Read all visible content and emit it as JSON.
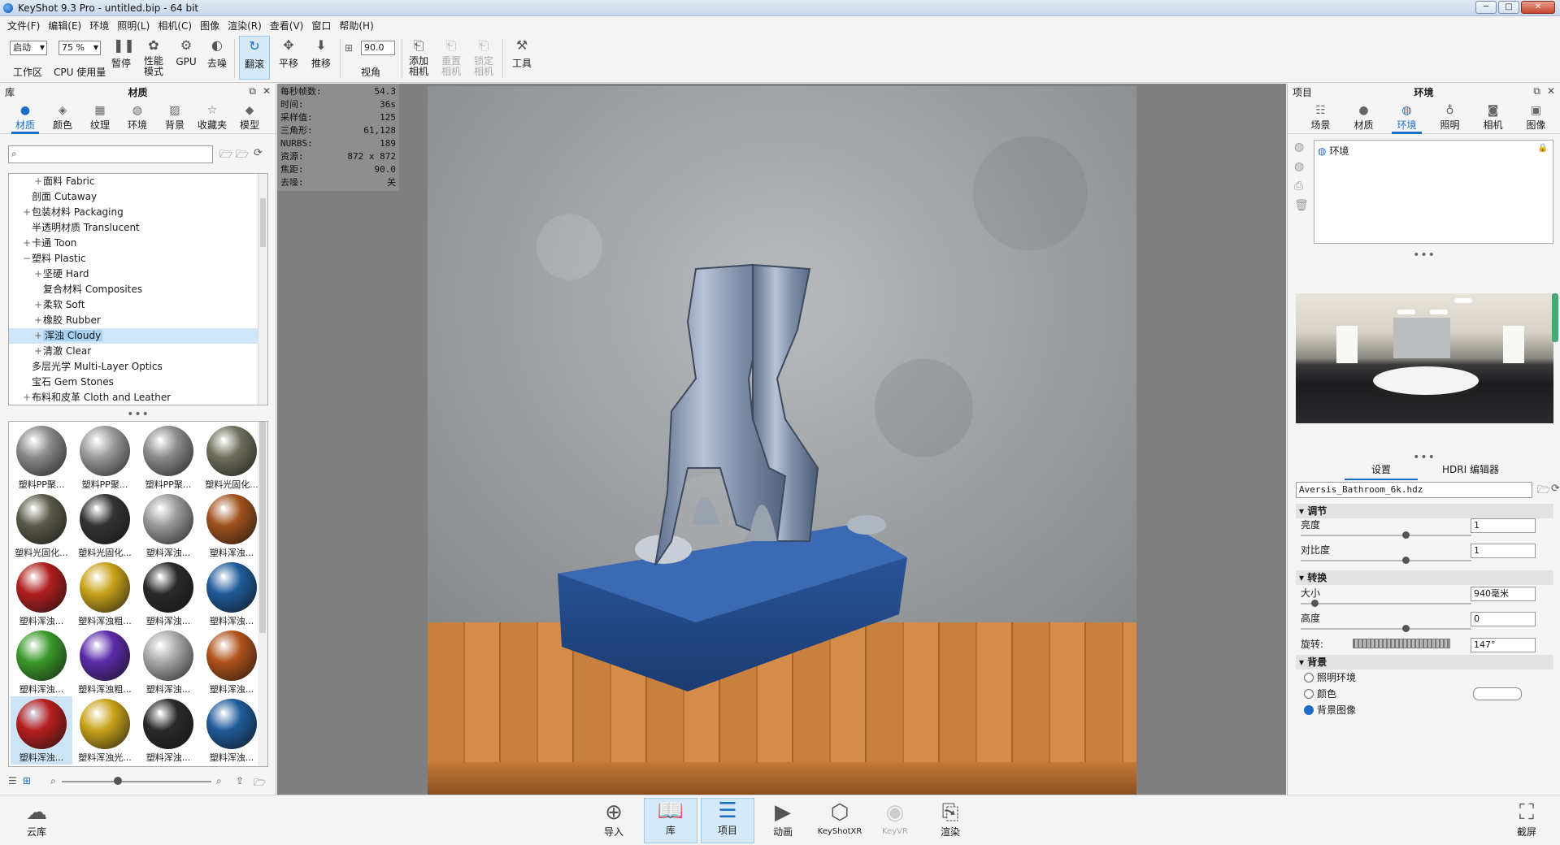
{
  "window": {
    "title": "KeyShot 9.3 Pro  - untitled.bip  - 64 bit",
    "min": "─",
    "max": "□",
    "close": "✕"
  },
  "menu": [
    "文件(F)",
    "编辑(E)",
    "环境",
    "照明(L)",
    "相机(C)",
    "图像",
    "渲染(R)",
    "查看(V)",
    "窗口",
    "帮助(H)"
  ],
  "toolbar": {
    "workspace_select": "启动",
    "workspace_label": "工作区",
    "cpu_select": "75 %",
    "cpu_label": "CPU 使用量",
    "pause": "暂停",
    "perf_line1": "性能",
    "perf_line2": "模式",
    "gpu": "GPU",
    "denoise": "去噪",
    "tumble": "翻滚",
    "pan": "平移",
    "dolly": "推移",
    "fov_value": "90.0",
    "fov_label": "视角",
    "add_cam_1": "添加",
    "add_cam_2": "相机",
    "reset_cam_1": "重置",
    "reset_cam_2": "相机",
    "lock_cam_1": "锁定",
    "lock_cam_2": "相机",
    "tools": "工具"
  },
  "library": {
    "header_left": "库",
    "header_title": "材质",
    "tabs": [
      "材质",
      "颜色",
      "纹理",
      "环境",
      "背景",
      "收藏夹",
      "模型"
    ],
    "search_placeholder": "",
    "tree": [
      {
        "label": "面料 Fabric",
        "indent": 2,
        "exp": "+"
      },
      {
        "label": "剖面 Cutaway",
        "indent": 1,
        "exp": ""
      },
      {
        "label": "包装材料 Packaging",
        "indent": 1,
        "exp": "+"
      },
      {
        "label": "半透明材质 Translucent",
        "indent": 1,
        "exp": ""
      },
      {
        "label": "卡通 Toon",
        "indent": 1,
        "exp": "+"
      },
      {
        "label": "塑料 Plastic",
        "indent": 1,
        "exp": "−"
      },
      {
        "label": "坚硬 Hard",
        "indent": 2,
        "exp": "+"
      },
      {
        "label": "复合材料 Composites",
        "indent": 2,
        "exp": ""
      },
      {
        "label": "柔软 Soft",
        "indent": 2,
        "exp": "+"
      },
      {
        "label": "橡胶 Rubber",
        "indent": 2,
        "exp": "+"
      },
      {
        "label": "浑浊 Cloudy",
        "indent": 2,
        "exp": "+",
        "selected": true
      },
      {
        "label": "清澈 Clear",
        "indent": 2,
        "exp": "+"
      },
      {
        "label": "多层光学 Multi-Layer Optics",
        "indent": 1,
        "exp": ""
      },
      {
        "label": "宝石 Gem Stones",
        "indent": 1,
        "exp": ""
      },
      {
        "label": "布料和皮革 Cloth and Leather",
        "indent": 1,
        "exp": "+"
      }
    ],
    "thumbnails": [
      {
        "label": "塑料PP聚...",
        "color": "#8a8a8a"
      },
      {
        "label": "塑料PP聚...",
        "color": "#9a9a9a"
      },
      {
        "label": "塑料PP聚...",
        "color": "#8c8c8c"
      },
      {
        "label": "塑料光固化...",
        "color": "#6f6f5c"
      },
      {
        "label": "塑料光固化...",
        "color": "#5c5a48"
      },
      {
        "label": "塑料光固化...",
        "color": "#333333"
      },
      {
        "label": "塑料浑浊...",
        "color": "#9a9a9a"
      },
      {
        "label": "塑料浑浊...",
        "color": "#a0521d"
      },
      {
        "label": "塑料浑浊...",
        "color": "#b01e1e"
      },
      {
        "label": "塑料浑浊粗...",
        "color": "#c8a21a"
      },
      {
        "label": "塑料浑浊...",
        "color": "#2a2a2a"
      },
      {
        "label": "塑料浑浊...",
        "color": "#1f5b9a"
      },
      {
        "label": "塑料浑浊...",
        "color": "#3a9a2a"
      },
      {
        "label": "塑料浑浊粗...",
        "color": "#5a2aa8"
      },
      {
        "label": "塑料浑浊...",
        "color": "#a8a8a8"
      },
      {
        "label": "塑料浑浊...",
        "color": "#b0521a"
      },
      {
        "label": "塑料浑浊...",
        "color": "#b81e1e",
        "selected": true
      },
      {
        "label": "塑料浑浊光...",
        "color": "#c8a21a"
      },
      {
        "label": "塑料浑浊...",
        "color": "#2a2a2a"
      },
      {
        "label": "塑料浑浊...",
        "color": "#1f5b9a"
      }
    ]
  },
  "viewport": {
    "stats": [
      {
        "k": "每秒帧数:",
        "v": "54.3"
      },
      {
        "k": "时间:",
        "v": "36s"
      },
      {
        "k": "采样值:",
        "v": "125"
      },
      {
        "k": "三角形:",
        "v": "61,128"
      },
      {
        "k": "NURBS:",
        "v": "189"
      },
      {
        "k": "资源:",
        "v": "872 x 872"
      },
      {
        "k": "焦距:",
        "v": "90.0"
      },
      {
        "k": "去噪:",
        "v": "关"
      }
    ]
  },
  "project": {
    "header_left": "项目",
    "header_title": "环境",
    "tabs": [
      "场景",
      "材质",
      "环境",
      "照明",
      "相机",
      "图像"
    ],
    "env_item": "环境",
    "subtab_settings": "设置",
    "subtab_hdri": "HDRI 编辑器",
    "hdr_file": "Aversis_Bathroom_6k.hdz",
    "sec_adjust": "调节",
    "brightness_label": "亮度",
    "brightness_value": "1",
    "contrast_label": "对比度",
    "contrast_value": "1",
    "sec_transform": "转换",
    "size_label": "大小",
    "size_value": "940毫米",
    "height_label": "高度",
    "height_value": "0",
    "rotation_label": "旋转:",
    "rotation_value": "147°",
    "sec_background": "背景",
    "bg_lighting": "照明环境",
    "bg_color": "颜色",
    "bg_image": "背景图像"
  },
  "bottom": {
    "cloud": "云库",
    "import": "导入",
    "library": "库",
    "project": "项目",
    "animation": "动画",
    "keyshotxr": "KeyShotXR",
    "keyvr": "KeyVR",
    "render": "渲染",
    "screenshot": "截屏"
  }
}
